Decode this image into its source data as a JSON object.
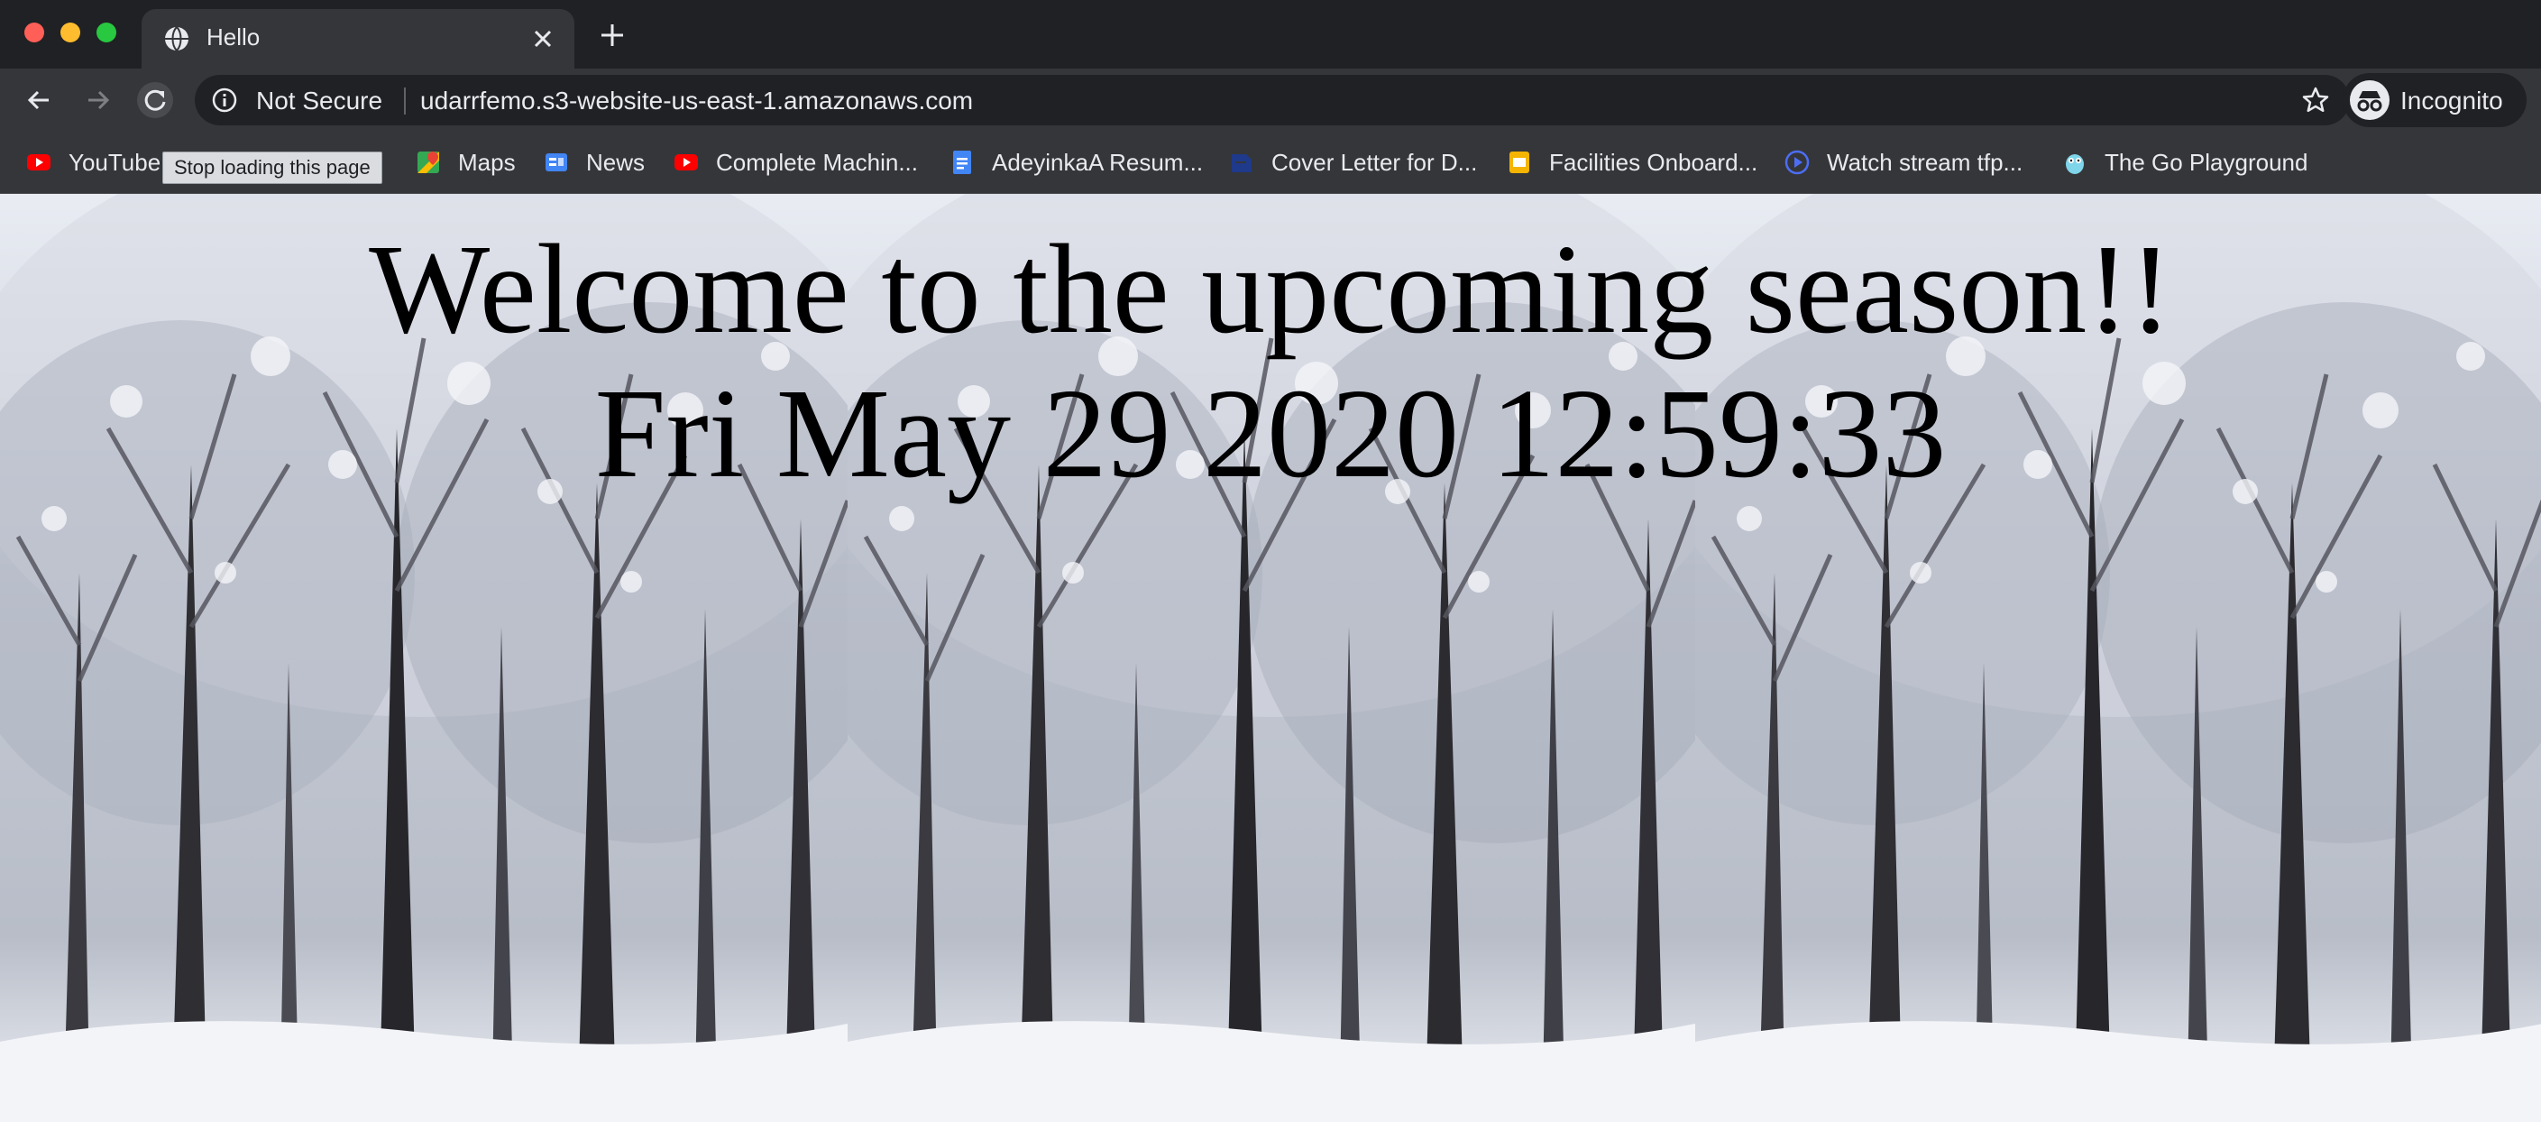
{
  "browser": {
    "tab": {
      "title": "Hello"
    },
    "omnibox": {
      "security_label": "Not Secure",
      "url": "udarrfemo.s3-website-us-east-1.amazonaws.com"
    },
    "profile": {
      "label": "Incognito"
    },
    "tooltip": "Stop loading this page",
    "bookmarks": [
      {
        "label": "YouTube",
        "icon": "youtube-icon"
      },
      {
        "label": "Maps",
        "icon": "maps-icon"
      },
      {
        "label": "News",
        "icon": "news-icon"
      },
      {
        "label": "Complete Machin...",
        "icon": "youtube-icon"
      },
      {
        "label": "AdeyinkaA Resum...",
        "icon": "docs-icon"
      },
      {
        "label": "Cover Letter for D...",
        "icon": "doc-icon"
      },
      {
        "label": "Facilities Onboard...",
        "icon": "slides-icon"
      },
      {
        "label": "Watch stream tfp...",
        "icon": "play-icon"
      },
      {
        "label": "The Go Playground",
        "icon": "gopher-icon"
      }
    ],
    "colors": {
      "chrome_dark": "#202124",
      "toolbar": "#35363a",
      "text": "#e8eaed"
    }
  },
  "page": {
    "heading": "Welcome to the upcoming season!!",
    "datetime": "Fri May 29 2020 12:59:33",
    "background": "snowy-forest-image"
  }
}
